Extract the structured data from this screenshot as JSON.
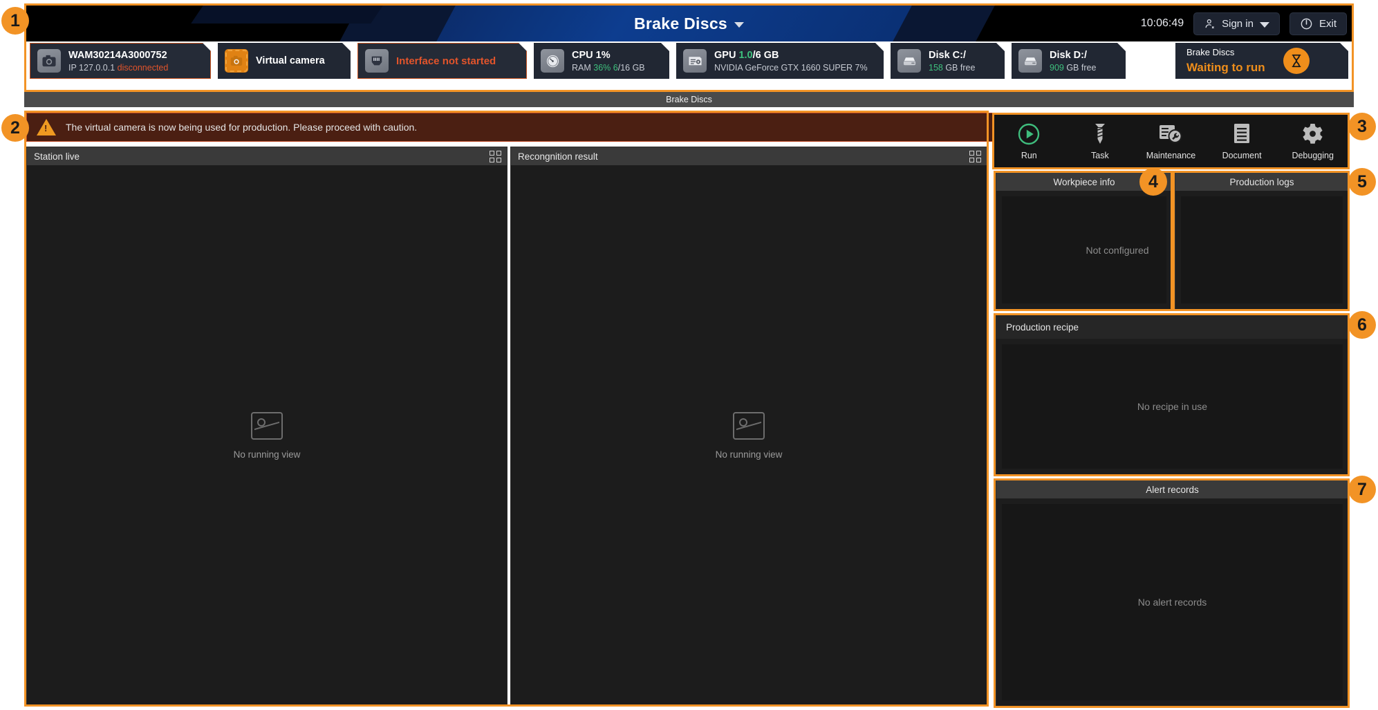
{
  "header": {
    "title": "Brake Discs",
    "clock": "10:06:49",
    "sign_in_label": "Sign in",
    "exit_label": "Exit",
    "caret_icon": "chevron-down-icon",
    "user_icon": "user-icon",
    "power_icon": "power-icon"
  },
  "status_cards": [
    {
      "icon": "camera-icon",
      "line1": "WAM30214A3000752",
      "line2_prefix": "IP 127.0.0.1",
      "line2_status": "disconnected",
      "style": "alert"
    },
    {
      "icon": "virtual-camera-icon",
      "line1": "Virtual camera",
      "line2_prefix": "",
      "line2_status": "",
      "style": "normal"
    },
    {
      "icon": "ethernet-port-icon",
      "line1": "Interface not started",
      "line2_prefix": "",
      "line2_status": "",
      "style": "alert-text"
    },
    {
      "icon": "cpu-gauge-icon",
      "line1": "CPU 1%",
      "line2_prefix": "RAM ",
      "line2_value": "36%",
      "line2_value2": "6",
      "line2_suffix": "/16 GB",
      "style": "metric"
    },
    {
      "icon": "gpu-card-icon",
      "line1_prefix": "GPU ",
      "line1_value": "1.0",
      "line1_suffix": "/6 GB",
      "line2": "NVIDIA GeForce GTX 1660 SUPER 7%",
      "style": "metric2"
    },
    {
      "icon": "disk-icon",
      "line1": "Disk C:/",
      "line2_value": "158",
      "line2_suffix": " GB free",
      "style": "disk"
    },
    {
      "icon": "disk-icon",
      "line1": "Disk D:/",
      "line2_value": "909",
      "line2_suffix": " GB free",
      "style": "disk"
    }
  ],
  "run_state": {
    "name": "Brake Discs",
    "status": "Waiting to run",
    "icon": "hourglass-icon"
  },
  "breadcrumb": "Brake Discs",
  "warning": {
    "icon": "warning-triangle-icon",
    "text": "The virtual camera is now being used for production. Please proceed with caution."
  },
  "viewports": [
    {
      "title": "Station live",
      "empty_text": "No running view",
      "grid_icon": "grid-layout-icon",
      "placeholder_icon": "image-placeholder-icon"
    },
    {
      "title": "Recongnition result",
      "empty_text": "No running view",
      "grid_icon": "grid-layout-icon",
      "placeholder_icon": "image-placeholder-icon"
    }
  ],
  "toolbar": [
    {
      "label": "Run",
      "icon": "play-circle-icon"
    },
    {
      "label": "Task",
      "icon": "screw-icon"
    },
    {
      "label": "Maintenance",
      "icon": "maintenance-wrench-icon"
    },
    {
      "label": "Document",
      "icon": "document-icon"
    },
    {
      "label": "Debugging",
      "icon": "gear-icon"
    }
  ],
  "panels": {
    "workpiece_info": {
      "title": "Workpiece info",
      "empty_text": "Not configured"
    },
    "production_logs": {
      "title": "Production logs",
      "empty_text": ""
    },
    "production_recipe": {
      "title": "Production recipe",
      "empty_text": "No recipe in use"
    },
    "alert_records": {
      "title": "Alert records",
      "empty_text": "No alert records"
    }
  },
  "callouts": [
    "1",
    "2",
    "3",
    "4",
    "5",
    "6",
    "7"
  ],
  "colors": {
    "accent": "#F29325",
    "alert_red": "#e2542b",
    "green": "#3ec07d",
    "orange": "#ef8e1b"
  }
}
